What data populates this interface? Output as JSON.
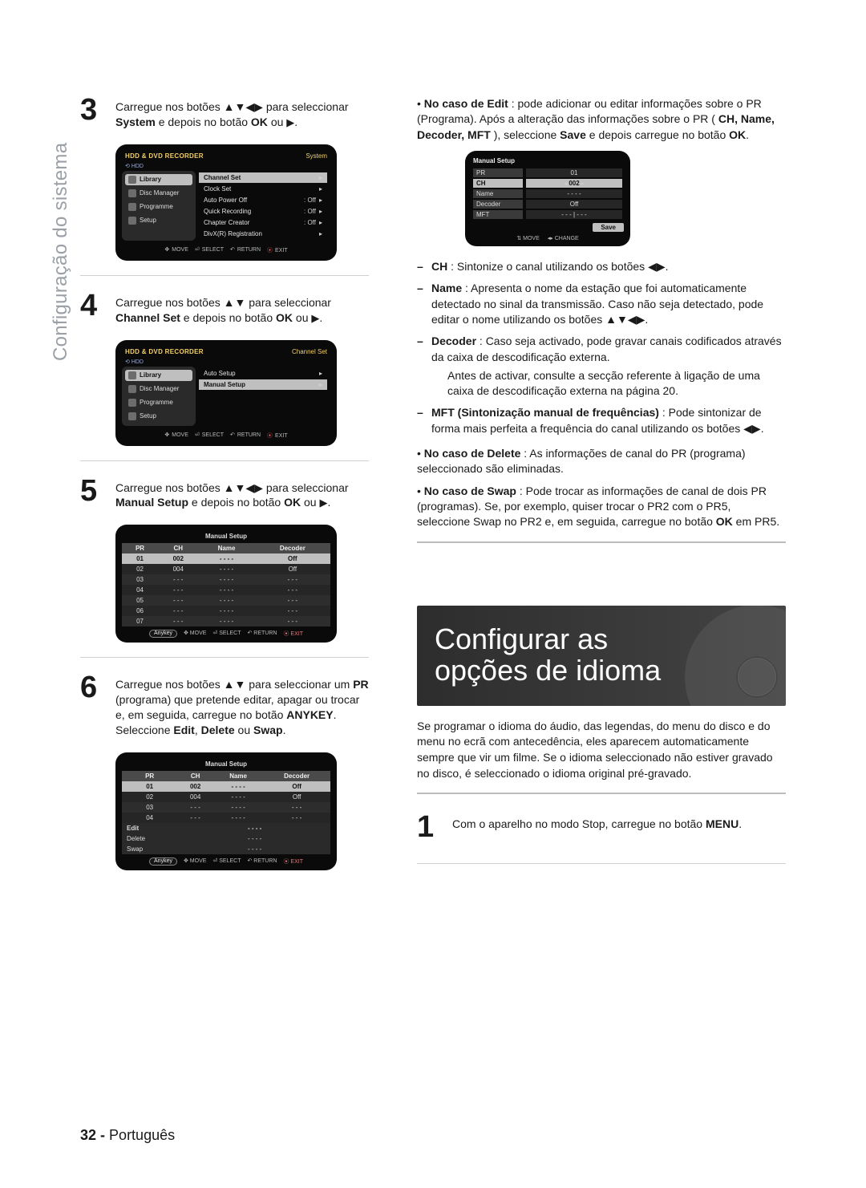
{
  "side_label": "Configuração do sistema",
  "page_footer": {
    "page": "32 -",
    "lang": "Português"
  },
  "step3": {
    "num": "3",
    "pre": "Carregue nos botões ",
    "after": " para seleccionar ",
    "bold": "System",
    "tail": " e depois no botão ",
    "ok": "OK",
    "ou": " ou "
  },
  "shot3": {
    "title": "HDD & DVD RECORDER",
    "context": "System",
    "hdd": "HDD",
    "nav": [
      "Library",
      "Disc Manager",
      "Programme",
      "Setup"
    ],
    "nav_sel": 0,
    "items": [
      {
        "label": "Channel Set",
        "val": "",
        "sel": true,
        "arr": true
      },
      {
        "label": "Clock Set",
        "val": "",
        "arr": true
      },
      {
        "label": "Auto Power Off",
        "val": ": Off",
        "arr": true
      },
      {
        "label": "Quick Recording",
        "val": ": Off",
        "arr": true
      },
      {
        "label": "Chapter Creator",
        "val": ": Off",
        "arr": true
      },
      {
        "label": "DivX(R) Registration",
        "val": "",
        "arr": true
      }
    ],
    "footer": [
      "MOVE",
      "SELECT",
      "RETURN",
      "EXIT"
    ]
  },
  "step4": {
    "num": "4",
    "pre": "Carregue nos botões ",
    "after": "para seleccionar ",
    "bold": "Channel Set",
    "tail": " e depois no botão ",
    "ok": "OK",
    "ou": " ou "
  },
  "shot4": {
    "title": "HDD & DVD RECORDER",
    "context": "Channel Set",
    "hdd": "HDD",
    "nav": [
      "Library",
      "Disc Manager",
      "Programme",
      "Setup"
    ],
    "nav_sel": 0,
    "items": [
      {
        "label": "Auto Setup",
        "val": "",
        "arr": true
      },
      {
        "label": "Manual Setup",
        "val": "",
        "sel": true,
        "arr": true
      }
    ],
    "footer": [
      "MOVE",
      "SELECT",
      "RETURN",
      "EXIT"
    ]
  },
  "step5": {
    "num": "5",
    "pre": "Carregue nos botões ",
    "after": " para seleccionar ",
    "bold": "Manual Setup",
    "tail": " e depois no botão ",
    "ok": "OK",
    "ou": " ou "
  },
  "tbl5": {
    "title": "Manual Setup",
    "headers": [
      "PR",
      "CH",
      "Name",
      "Decoder"
    ],
    "rows": [
      [
        "01",
        "002",
        "- - - -",
        "Off"
      ],
      [
        "02",
        "004",
        "- - - -",
        "Off"
      ],
      [
        "03",
        "- - -",
        "- - - -",
        "- - -"
      ],
      [
        "04",
        "- - -",
        "- - - -",
        "- - -"
      ],
      [
        "05",
        "- - -",
        "- - - -",
        "- - -"
      ],
      [
        "06",
        "- - -",
        "- - - -",
        "- - -"
      ],
      [
        "07",
        "- - -",
        "- - - -",
        "- - -"
      ]
    ],
    "sel_row": 0,
    "anykey": "Anykey",
    "footer": [
      "MOVE",
      "SELECT",
      "RETURN",
      "EXIT"
    ]
  },
  "step6": {
    "num": "6",
    "pre": "Carregue nos botões ",
    "after": " para seleccionar um ",
    "bold": "PR",
    "line2": "(programa) que pretende editar, apagar ou trocar e, em seguida, carregue no botão ",
    "anykey": "ANYKEY",
    "sel": "Seleccione ",
    "e": "Edit",
    "d": "Delete",
    "s": "Swap",
    "ou": " ou ",
    "dot": "."
  },
  "tbl6": {
    "title": "Manual Setup",
    "headers": [
      "PR",
      "CH",
      "Name",
      "Decoder"
    ],
    "rows": [
      [
        "01",
        "002",
        "- - - -",
        "Off"
      ],
      [
        "02",
        "004",
        "- - - -",
        "Off"
      ],
      [
        "03",
        "- - -",
        "- - - -",
        "- - -"
      ],
      [
        "04",
        "- - -",
        "- - - -",
        "- - -"
      ]
    ],
    "menu": [
      "Edit",
      "Delete",
      "Swap"
    ],
    "anykey": "Anykey",
    "footer": [
      "MOVE",
      "SELECT",
      "RETURN",
      "EXIT"
    ]
  },
  "right_top": {
    "bullet": "• ",
    "lead_bold": "No caso de Edit",
    "lead_after": " : pode adicionar ou editar informações sobre o PR (Programa). Após a alteração das informações sobre o PR (",
    "fields": "CH, Name, Decoder, MFT",
    "lead_close": "), seleccione ",
    "save": "Save",
    "lead_tail": " e depois carregue no botão ",
    "ok": "OK",
    "dot": "."
  },
  "modal": {
    "title": "Manual Setup",
    "rows": [
      {
        "k": "PR",
        "v": "01"
      },
      {
        "k": "CH",
        "v": "002",
        "sel": true,
        "tri": true
      },
      {
        "k": "Name",
        "v": "- - - -"
      },
      {
        "k": "Decoder",
        "v": "Off"
      },
      {
        "k": "MFT",
        "v": "- - - | - - -"
      }
    ],
    "save": "Save",
    "footer": [
      "MOVE",
      "CHANGE"
    ]
  },
  "defs": {
    "ch": {
      "k": "CH",
      "t": " : Sintonize o canal utilizando os botões "
    },
    "name": {
      "k": "Name",
      "t": " : Apresenta o nome da estação que foi automaticamente detectado no sinal da transmissão. Caso não seja detectado, pode editar o nome utilizando os botões "
    },
    "decoder": {
      "k": "Decoder",
      "t": " : Caso seja activado, pode gravar canais codificados através da caixa de descodificação externa.",
      "t2": "Antes de activar, consulte a secção referente à ligação de uma caixa de descodificação externa na página 20."
    },
    "mft": {
      "k": "MFT (Sintonização manual de frequências)",
      "t": " : Pode sintonizar de forma mais perfeita a frequência do canal utilizando os botões "
    }
  },
  "del": {
    "b": "• ",
    "k": "No caso de Delete",
    "t": " : As informações de canal do PR (programa) seleccionado são eliminadas."
  },
  "swap": {
    "b": "• ",
    "k": "No caso de Swap",
    "t": " : Pode trocar as informações de canal de dois PR (programas). Se, por exemplo, quiser trocar o PR2 com o PR5, seleccione Swap no PR2 e, em seguida, carregue no botão ",
    "ok": "OK",
    "t2": " em PR5."
  },
  "hero": {
    "l1": "Configurar as",
    "l2": "opções de idioma"
  },
  "right_para": "Se programar o idioma do áudio, das legendas, do menu do disco e do menu no ecrã com antecedência, eles aparecem automaticamente sempre que vir um filme. Se o idioma seleccionado não estiver gravado no disco, é seleccionado o idioma original pré-gravado.",
  "step1": {
    "num": "1",
    "pre": "Com o aparelho no modo Stop, carregue no botão ",
    "menu": "MENU",
    "dot": "."
  },
  "glyphs": {
    "up": "▲",
    "down": "▼",
    "left": "◀",
    "right": "▶",
    "play": "▶",
    "dot": "•"
  }
}
